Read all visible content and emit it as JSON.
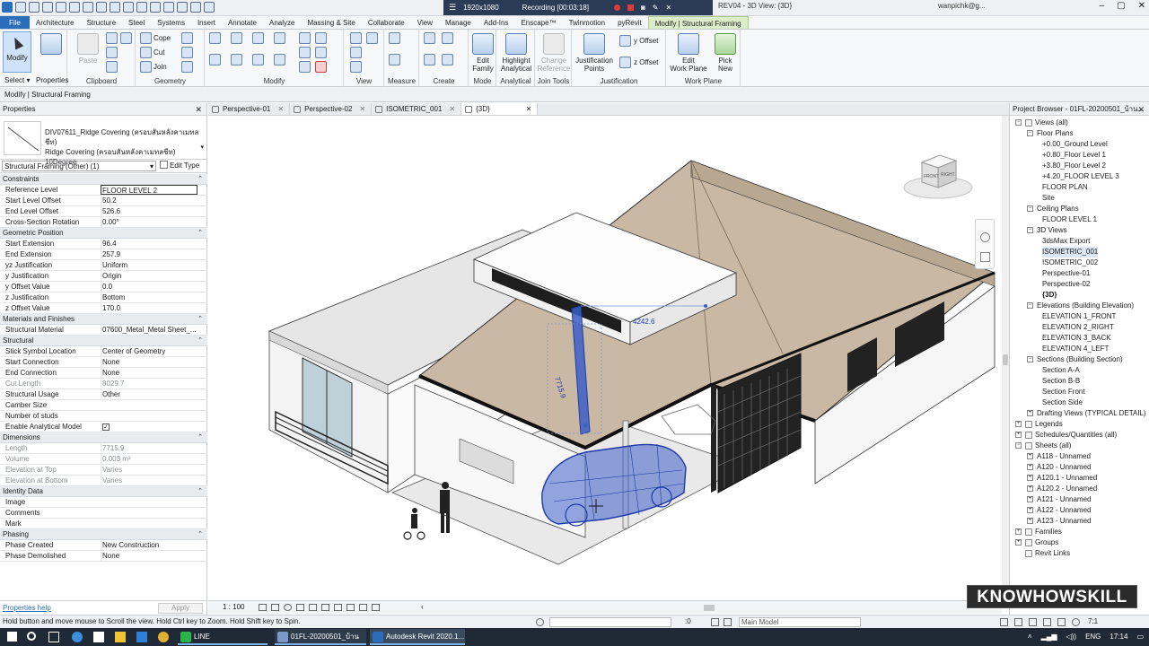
{
  "titlebar": {
    "recording_res": "1920x1080",
    "recording_label": "Recording [00:03:18]",
    "doc_title": "REV04 - 3D View: {3D}",
    "user": "wanpichk@g...",
    "minimize": "–",
    "maximize": "▢",
    "close": "✕"
  },
  "tabs": [
    "File",
    "Architecture",
    "Structure",
    "Steel",
    "Systems",
    "Insert",
    "Annotate",
    "Analyze",
    "Massing & Site",
    "Collaborate",
    "View",
    "Manage",
    "Add-Ins",
    "Enscape™",
    "Twinmotion",
    "pyRevit",
    "Modify | Structural Framing"
  ],
  "ribbon": {
    "modify": "Modify",
    "select": "Select ▾",
    "properties": "Properties",
    "paste": "Paste",
    "clipboard": "Clipboard",
    "cope": "Cope",
    "cut": "Cut",
    "join": "Join",
    "geometry": "Geometry",
    "modify_panel": "Modify",
    "view": "View",
    "measure": "Measure",
    "create": "Create",
    "edit_family_1": "Edit",
    "edit_family_2": "Family",
    "mode": "Mode",
    "highlight_1": "Highlight",
    "highlight_2": "Analytical",
    "analytical": "Analytical",
    "change_ref_1": "Change",
    "change_ref_2": "Reference",
    "join_tools": "Join Tools",
    "just_points_1": "Justification",
    "just_points_2": "Points",
    "y_offset": "y Offset",
    "z_offset": "z Offset",
    "justification": "Justification",
    "edit_wp_1": "Edit",
    "edit_wp_2": "Work Plane",
    "pick_new_1": "Pick",
    "pick_new_2": "New",
    "work_plane": "Work Plane"
  },
  "options_bar": "Modify | Structural Framing",
  "properties": {
    "title": "Properties",
    "type_name_1": "DIV07611_Ridge Covering (ครอบสันหลังคาเมทลชีท)",
    "type_name_2": "Ridge Covering (ครอบสันหลังคาเมทลชีท) 10Degree",
    "filter": "Structural Framing (Other) (1)",
    "edit_type": "Edit Type",
    "groups": [
      {
        "name": "Constraints",
        "rows": [
          {
            "k": "Reference Level",
            "v": "FLOOR LEVEL 2",
            "sel": true
          },
          {
            "k": "Start Level Offset",
            "v": "50.2"
          },
          {
            "k": "End Level Offset",
            "v": "526.6"
          },
          {
            "k": "Cross-Section Rotation",
            "v": "0.00°"
          }
        ]
      },
      {
        "name": "Geometric Position",
        "rows": [
          {
            "k": "Start Extension",
            "v": "96.4"
          },
          {
            "k": "End Extension",
            "v": "257.9"
          },
          {
            "k": "yz Justification",
            "v": "Uniform"
          },
          {
            "k": "y Justification",
            "v": "Origin"
          },
          {
            "k": "y Offset Value",
            "v": "0.0"
          },
          {
            "k": "z Justification",
            "v": "Bottom"
          },
          {
            "k": "z Offset Value",
            "v": "170.0"
          }
        ]
      },
      {
        "name": "Materials and Finishes",
        "rows": [
          {
            "k": "Structural Material",
            "v": "07600_Metal_Metal Sheet_..."
          }
        ]
      },
      {
        "name": "Structural",
        "rows": [
          {
            "k": "Stick Symbol Location",
            "v": "Center of Geometry"
          },
          {
            "k": "Start Connection",
            "v": "None"
          },
          {
            "k": "End Connection",
            "v": "None"
          },
          {
            "k": "Cut Length",
            "v": "8029.7",
            "ro": true
          },
          {
            "k": "Structural Usage",
            "v": "Other"
          },
          {
            "k": "Camber Size",
            "v": ""
          },
          {
            "k": "Number of studs",
            "v": ""
          },
          {
            "k": "Enable Analytical Model",
            "v": "✓",
            "chk": true
          }
        ]
      },
      {
        "name": "Dimensions",
        "rows": [
          {
            "k": "Length",
            "v": "7715.9",
            "ro": true
          },
          {
            "k": "Volume",
            "v": "0.003 m³",
            "ro": true
          },
          {
            "k": "Elevation at Top",
            "v": "Varies",
            "ro": true
          },
          {
            "k": "Elevation at Bottom",
            "v": "Varies",
            "ro": true
          }
        ]
      },
      {
        "name": "Identity Data",
        "rows": [
          {
            "k": "Image",
            "v": ""
          },
          {
            "k": "Comments",
            "v": ""
          },
          {
            "k": "Mark",
            "v": ""
          }
        ]
      },
      {
        "name": "Phasing",
        "rows": [
          {
            "k": "Phase Created",
            "v": "New Construction"
          },
          {
            "k": "Phase Demolished",
            "v": "None"
          }
        ]
      }
    ],
    "help": "Properties help",
    "apply": "Apply"
  },
  "view_tabs": [
    "Perspective-01",
    "Perspective-02",
    "ISOMETRIC_001",
    "{3D}"
  ],
  "viewport": {
    "dim_1": "7715.9",
    "dim_2": "4242.6",
    "cube_front": "FRONT",
    "cube_right": "RIGHT"
  },
  "view_control": {
    "scale": "1 : 100"
  },
  "browser": {
    "title": "Project Browser - 01FL-20200501_บ้าน...",
    "tree": [
      {
        "t": "Views (all)",
        "d": 0,
        "e": "-"
      },
      {
        "t": "Floor Plans",
        "d": 1,
        "e": "-"
      },
      {
        "t": "+0.00_Ground Level",
        "d": 2
      },
      {
        "t": "+0.80_Floor Level 1",
        "d": 2
      },
      {
        "t": "+3.80_Floor Level 2",
        "d": 2
      },
      {
        "t": "+4.20_FLOOR LEVEL 3",
        "d": 2
      },
      {
        "t": "FLOOR PLAN",
        "d": 2
      },
      {
        "t": "Site",
        "d": 2
      },
      {
        "t": "Ceiling Plans",
        "d": 1,
        "e": "-"
      },
      {
        "t": "FLOOR LEVEL 1",
        "d": 2
      },
      {
        "t": "3D Views",
        "d": 1,
        "e": "-"
      },
      {
        "t": "3dsMax Export",
        "d": 2
      },
      {
        "t": "ISOMETRIC_001",
        "d": 2,
        "sel": true
      },
      {
        "t": "ISOMETRIC_002",
        "d": 2
      },
      {
        "t": "Perspective-01",
        "d": 2
      },
      {
        "t": "Perspective-02",
        "d": 2
      },
      {
        "t": "{3D}",
        "d": 2,
        "b": true
      },
      {
        "t": "Elevations (Building Elevation)",
        "d": 1,
        "e": "-"
      },
      {
        "t": "ELEVATION 1_FRONT",
        "d": 2
      },
      {
        "t": "ELEVATION 2_RIGHT",
        "d": 2
      },
      {
        "t": "ELEVATION 3_BACK",
        "d": 2
      },
      {
        "t": "ELEVATION 4_LEFT",
        "d": 2
      },
      {
        "t": "Sections (Building Section)",
        "d": 1,
        "e": "-"
      },
      {
        "t": "Section A-A",
        "d": 2
      },
      {
        "t": "Section B-B",
        "d": 2
      },
      {
        "t": "Section Front",
        "d": 2
      },
      {
        "t": "Section Side",
        "d": 2
      },
      {
        "t": "Drafting Views (TYPICAL DETAIL)",
        "d": 1,
        "e": "+"
      },
      {
        "t": "Legends",
        "d": 0,
        "e": "+",
        "i": true
      },
      {
        "t": "Schedules/Quantities (all)",
        "d": 0,
        "e": "+",
        "i": true
      },
      {
        "t": "Sheets (all)",
        "d": 0,
        "e": "-",
        "i": true
      },
      {
        "t": "A118 - Unnamed",
        "d": 1,
        "e": "+"
      },
      {
        "t": "A120 - Unnamed",
        "d": 1,
        "e": "+"
      },
      {
        "t": "A120.1 - Unnamed",
        "d": 1,
        "e": "+"
      },
      {
        "t": "A120.2 - Unnamed",
        "d": 1,
        "e": "+"
      },
      {
        "t": "A121 - Unnamed",
        "d": 1,
        "e": "+"
      },
      {
        "t": "A122 - Unnamed",
        "d": 1,
        "e": "+"
      },
      {
        "t": "A123 - Unnamed",
        "d": 1,
        "e": "+"
      },
      {
        "t": "Families",
        "d": 0,
        "e": "+",
        "i": true
      },
      {
        "t": "Groups",
        "d": 0,
        "e": "+",
        "i": true
      },
      {
        "t": "Revit Links",
        "d": 0,
        "i": true
      }
    ]
  },
  "watermark": "KNOWHOWSKILL",
  "status": {
    "message": "Hold button and move mouse to Scroll the view. Hold Ctrl key to Zoom. Hold Shift key to Spin.",
    "zero": ":0",
    "model": "Main Model",
    "filter": "7:1"
  },
  "taskbar": {
    "line": "LINE",
    "app1": "01FL-20200501_บ้านคุ...",
    "app2": "Autodesk Revit 2020.1...",
    "lang": "ENG",
    "time": "17:14"
  }
}
